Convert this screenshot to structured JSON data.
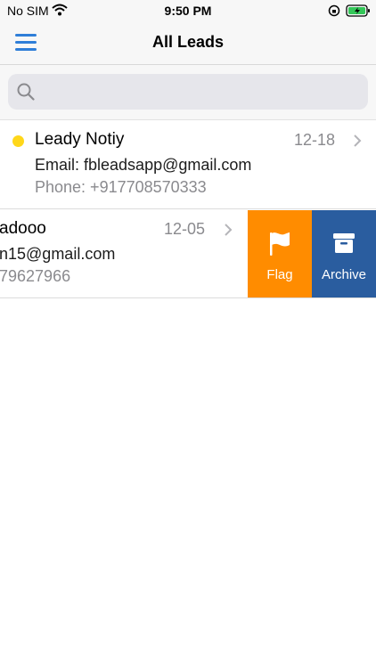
{
  "status_bar": {
    "carrier": "No SIM",
    "time": "9:50 PM"
  },
  "nav": {
    "title": "All Leads",
    "menu_icon": "hamburger-menu-icon"
  },
  "search": {
    "placeholder": "",
    "value": ""
  },
  "leads": [
    {
      "name": "Leady Notiy",
      "date": "12-18",
      "email": "Email: fbleadsapp@gmail.com",
      "phone": "Phone: +917708570333",
      "unread": true,
      "dot_color": "#ffd71a"
    },
    {
      "name": "adooo",
      "date": "12-05",
      "email": "n15@gmail.com",
      "phone": "79627966",
      "unread": false
    }
  ],
  "swipe_actions": [
    {
      "label": "Flag",
      "icon": "flag-icon",
      "color": "#ff8c00"
    },
    {
      "label": "Archive",
      "icon": "archive-icon",
      "color": "#2a5d9f"
    }
  ],
  "colors": {
    "accent": "#2f7ed8",
    "nav_background": "#f7f7f7"
  }
}
